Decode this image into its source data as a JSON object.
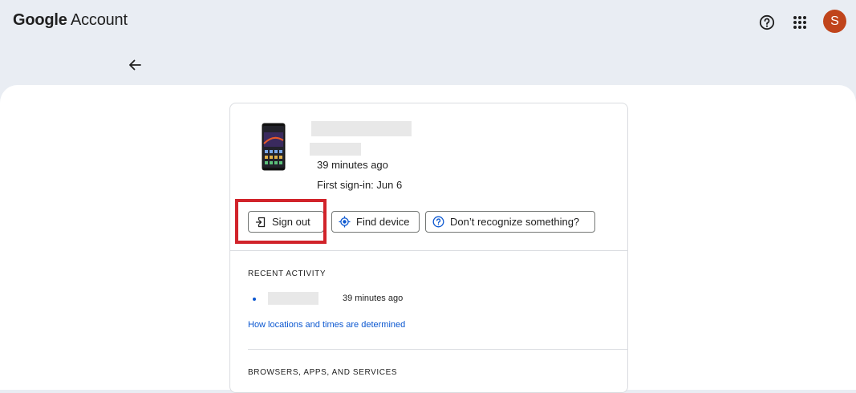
{
  "header": {
    "brand_google": "Google",
    "brand_account": "Account",
    "avatar_initial": "S",
    "icons": [
      "help-icon",
      "apps-grid-icon"
    ]
  },
  "nav": {
    "back_icon": "arrow-left-icon"
  },
  "device": {
    "last_seen": "39 minutes ago",
    "first_signin": "First sign-in: Jun 6",
    "actions": {
      "sign_out": "Sign out",
      "find_device": "Find device",
      "dont_recognize": "Don’t recognize something?"
    }
  },
  "recent_activity": {
    "heading": "RECENT ACTIVITY",
    "items": [
      {
        "time": "39 minutes ago"
      }
    ],
    "link": "How locations and times are determined"
  },
  "browsers": {
    "heading": "BROWSERS, APPS, AND SERVICES"
  },
  "colors": {
    "page_bg": "#e9edf3",
    "avatar": "#c0441b",
    "link": "#0b57d0",
    "highlight": "#d1232a"
  }
}
